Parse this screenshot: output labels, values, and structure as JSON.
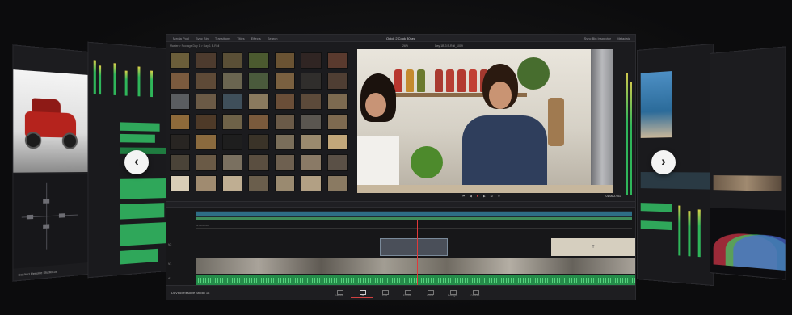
{
  "carousel": {
    "prev_label": "‹",
    "next_label": "›"
  },
  "fusion_panel": {
    "app_label": "DaVinci Resolve Studio 18"
  },
  "main_window": {
    "title": "Quick 2 Cook 30sec",
    "topbar": {
      "media_pool": "Media Pool",
      "sync_bin": "Sync Bin",
      "transitions": "Transitions",
      "titles": "Titles",
      "effects": "Effects",
      "search": "Search",
      "right_info": "Sync Bin  Inspector",
      "right_info2": "Metadata"
    },
    "media_path": "Master > Footage Day 1 > Day 1 B-Roll",
    "viewer_label": "Day 1B-3 B-Roll_1009",
    "viewer_zoom": "26%",
    "timecode": "01:00:27:01",
    "timeline_timecode": "01:00:00:00",
    "track_v2": "V2",
    "track_v1": "V1",
    "track_a1": "A1",
    "title_clip": "T"
  },
  "page_bar": {
    "brand": "DaVinci Resolve Studio 18",
    "pages": [
      {
        "label": "Media",
        "active": false
      },
      {
        "label": "Cut",
        "active": true
      },
      {
        "label": "Edit",
        "active": false
      },
      {
        "label": "Fusion",
        "active": false
      },
      {
        "label": "Color",
        "active": false
      },
      {
        "label": "Fairlight",
        "active": false
      },
      {
        "label": "Deliver",
        "active": false
      }
    ]
  },
  "colors": {
    "accent_green": "#2fb65a",
    "playhead_red": "#e0393a",
    "timeline_blue": "#2e6e86"
  },
  "thumb_colors": [
    "#6b5e3a",
    "#4d3b2e",
    "#5a4f36",
    "#4b5a2f",
    "#6a5333",
    "#302523",
    "#5a3a2e",
    "#7a5a3e",
    "#5e4a37",
    "#6a6550",
    "#4a5a3c",
    "#7a6040",
    "#302e2c",
    "#4f3e33",
    "#5a5d60",
    "#6b5a46",
    "#3f4f5a",
    "#8a7a5e",
    "#6a4e38",
    "#5c4a3a",
    "#7c6a50",
    "#8e6a3a",
    "#4e3a28",
    "#6e6248",
    "#7a5a3c",
    "#6a5a48",
    "#5a5650",
    "#7e6a50",
    "#282522",
    "#8a6a3e",
    "#1e1e1e",
    "#3a3328",
    "#7a6e5a",
    "#9a8a6e",
    "#c2a77a",
    "#4a4338",
    "#6a5a46",
    "#7a7060",
    "#5a4e40",
    "#6e6050",
    "#8a7a66",
    "#5a5046",
    "#d9cdb6",
    "#a08b70",
    "#bfae92",
    "#6a5e4c",
    "#9a8a70",
    "#b2a084",
    "#8a7a62"
  ]
}
